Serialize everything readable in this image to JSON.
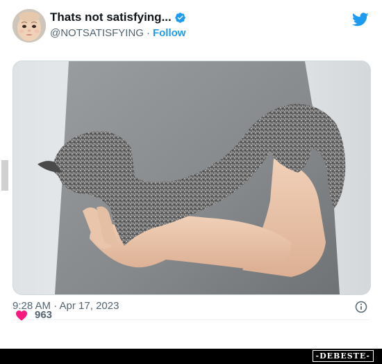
{
  "author": {
    "display_name": "Thats not satisfying...",
    "handle": "@NOTSATISFYING",
    "separator": "·",
    "follow_label": "Follow",
    "verified": true
  },
  "media": {
    "description_icon": "photo"
  },
  "meta": {
    "timestamp": "9:28 AM · Apr 17, 2023"
  },
  "engagement": {
    "like_count": "963"
  },
  "watermark": {
    "brand": "-DEBESTE-"
  },
  "colors": {
    "accent": "#1d9bf0",
    "heart": "#f91880",
    "secondary_text": "#536471"
  }
}
